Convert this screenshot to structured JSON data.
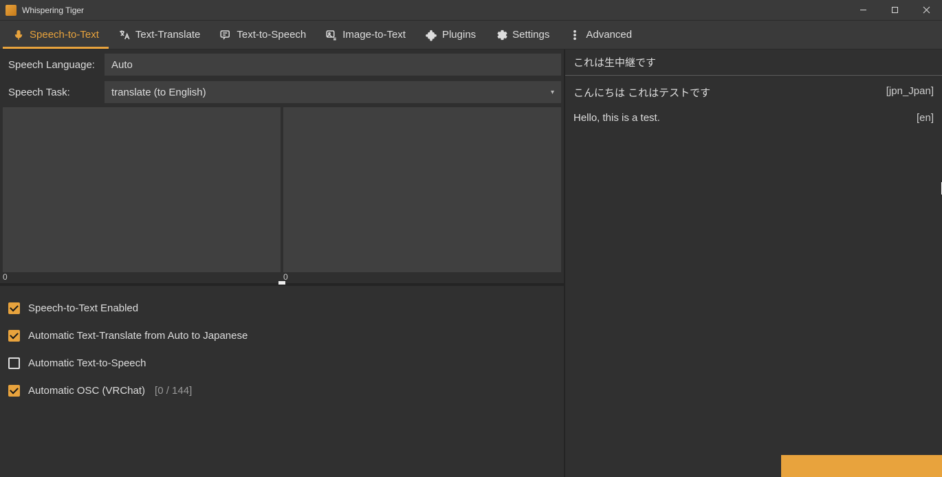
{
  "window": {
    "title": "Whispering Tiger"
  },
  "tabs": [
    {
      "label": "Speech-to-Text",
      "active": true
    },
    {
      "label": "Text-Translate"
    },
    {
      "label": "Text-to-Speech"
    },
    {
      "label": "Image-to-Text"
    },
    {
      "label": "Plugins"
    },
    {
      "label": "Settings"
    },
    {
      "label": "Advanced"
    }
  ],
  "form": {
    "speech_language_label": "Speech Language:",
    "speech_language_value": "Auto",
    "speech_task_label": "Speech Task:",
    "speech_task_value": "translate (to English)"
  },
  "wave": {
    "left_label": "0",
    "right_label": "0"
  },
  "checks": {
    "stt_enabled": {
      "label": "Speech-to-Text Enabled",
      "checked": true
    },
    "auto_translate": {
      "label": "Automatic Text-Translate from Auto to Japanese",
      "checked": true
    },
    "auto_tts": {
      "label": "Automatic Text-to-Speech",
      "checked": false
    },
    "auto_osc": {
      "label": "Automatic OSC (VRChat)",
      "checked": true,
      "counter": "[0 / 144]"
    }
  },
  "right_panel": {
    "header": "これは生中継です",
    "messages": [
      {
        "text": "こんにちは これはテストです",
        "tag": "[jpn_Jpan]"
      },
      {
        "text": "Hello, this is a test.",
        "tag": "[en]"
      }
    ]
  }
}
